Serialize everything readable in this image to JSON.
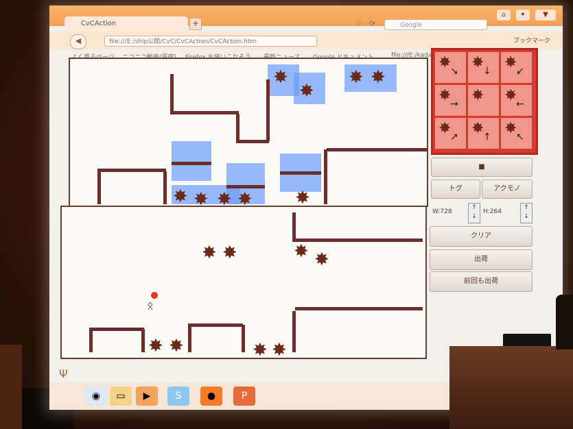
{
  "browser": {
    "tab_title": "CvCAction",
    "tab_plus": "+",
    "url": "file:///E:/ship公開/CvC/CvCAction/CvCAction.htm",
    "search_placeholder": "Google",
    "bookmark_menu": "ブックマーク",
    "bookmarks": [
      "よく見るページ",
      "ニコニコ動画(原宿)",
      "Firefox を使いこなそう",
      "最新ニュース",
      "Google ドキュメント...",
      "file:///E:/kadai%20-..."
    ]
  },
  "editor": {
    "stop_button": "■",
    "toggle_button": "トグ",
    "other_button": "アクモノ",
    "width_label": "W:728",
    "height_label": "H:264",
    "clear_button": "クリア",
    "ship_button": "出荷",
    "ship_prev_button": "前回も出荷",
    "arrows": [
      "↘",
      "↓",
      "↙",
      "→",
      "",
      "←",
      "↗",
      "↑",
      "↖"
    ]
  },
  "colors": {
    "block": "#6b2e2e",
    "water": "#6e9bff",
    "grid_border": "#d83a2e",
    "grid_cell": "#f1968a"
  },
  "icons": [
    "reload-icon",
    "home-icon",
    "star-icon",
    "search-icon",
    "folder-icon",
    "media-icon",
    "skype-icon",
    "firefox-icon",
    "paint-icon"
  ]
}
